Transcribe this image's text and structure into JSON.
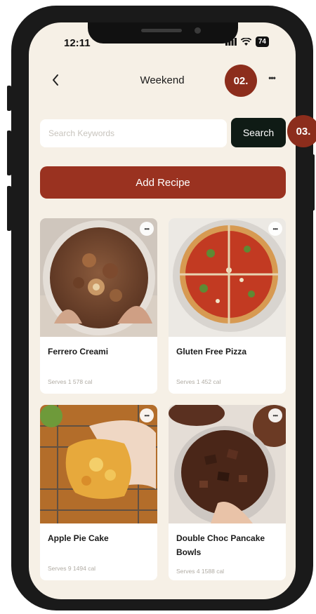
{
  "status": {
    "time": "12:11",
    "battery": "74"
  },
  "nav": {
    "title": "Weekend"
  },
  "search": {
    "placeholder": "Search Keywords",
    "value": "",
    "button_label": "Search"
  },
  "actions": {
    "add_recipe_label": "Add Recipe"
  },
  "recipes": [
    {
      "name": "Ferrero Creami",
      "serves": "Serves 1",
      "calories": "578 cal"
    },
    {
      "name": "Gluten Free Pizza",
      "serves": "Serves 1",
      "calories": "452 cal"
    },
    {
      "name": "Apple Pie Cake",
      "serves": "Serves 9",
      "calories": "1494 cal"
    },
    {
      "name": "Double Choc Pancake Bowls",
      "serves": "Serves 4",
      "calories": "1588 cal"
    }
  ],
  "callouts": {
    "menu_step": "02.",
    "search_step": "03."
  },
  "colors": {
    "background": "#f6f0e6",
    "accent": "#9a3220",
    "search_button": "#0f1b15",
    "badge": "#8c2d1c"
  },
  "icons": {
    "back": "chevron-left-icon",
    "menu": "more-horizontal-icon",
    "card_menu": "more-horizontal-icon",
    "wifi": "wifi-icon",
    "signal": "signal-icon"
  }
}
